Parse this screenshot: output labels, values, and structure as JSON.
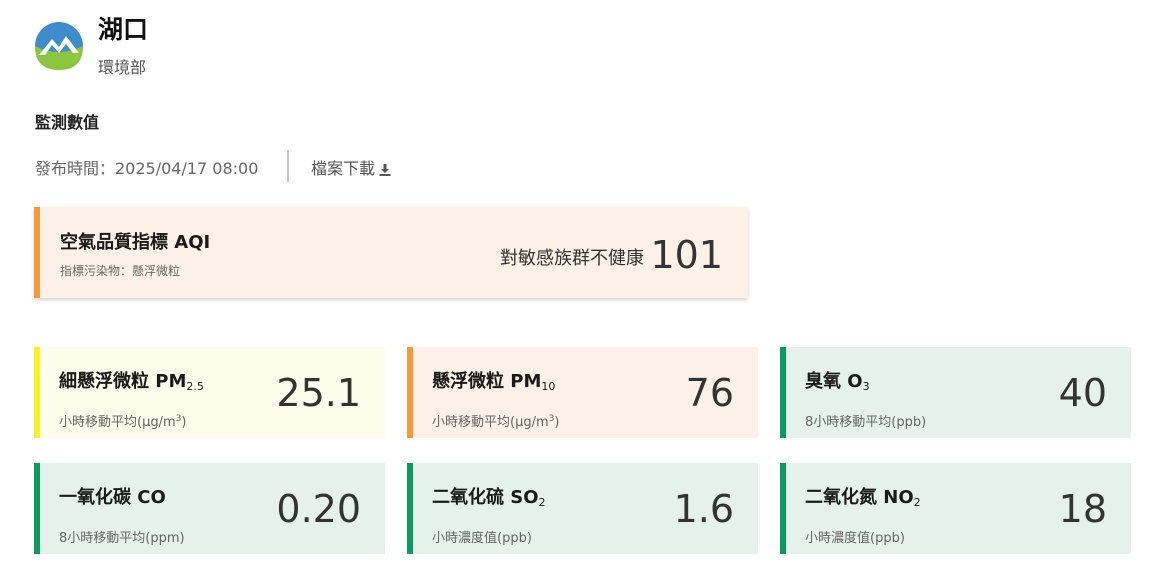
{
  "header": {
    "station_name": "湖口",
    "agency": "環境部",
    "logo_icon": "moenv-mountain-logo"
  },
  "section": {
    "title": "監測數值",
    "publish_time": "發布時間：2025/04/17 08:00",
    "download_label": "檔案下載",
    "download_icon": "download-icon"
  },
  "aqi": {
    "title": "空氣品質指標 AQI",
    "pollutant": "指標污染物：懸浮微粒",
    "status": "對敏感族群不健康",
    "value": "101",
    "color": "#f5993b",
    "background": "#fdf0e6"
  },
  "pollutants": [
    {
      "name": "細懸浮微粒 PM",
      "sub": "2.5",
      "unit": "小時移動平均(μg/m",
      "unit_sup": "3",
      "unit_end": ")",
      "value": "25.1",
      "color": "#f5f12a",
      "background": "#fefdeb"
    },
    {
      "name": "懸浮微粒 PM",
      "sub": "10",
      "unit": "小時移動平均(μg/m",
      "unit_sup": "3",
      "unit_end": ")",
      "value": "76",
      "color": "#f5993b",
      "background": "#fdf0e6"
    },
    {
      "name": "臭氧 O",
      "sub": "3",
      "unit": "8小時移動平均(ppb)",
      "value": "40",
      "color": "#0d9a62",
      "background": "#e5f2ec"
    },
    {
      "name": "一氧化碳 CO",
      "sub": "",
      "unit": "8小時移動平均(ppm)",
      "value": "0.20",
      "color": "#0d9a62",
      "background": "#e5f2ec"
    },
    {
      "name": "二氧化硫 SO",
      "sub": "2",
      "unit": "小時濃度值(ppb)",
      "value": "1.6",
      "color": "#0d9a62",
      "background": "#e5f2ec"
    },
    {
      "name": "二氧化氮 NO",
      "sub": "2",
      "unit": "小時濃度值(ppb)",
      "value": "18",
      "color": "#0d9a62",
      "background": "#e5f2ec"
    }
  ]
}
